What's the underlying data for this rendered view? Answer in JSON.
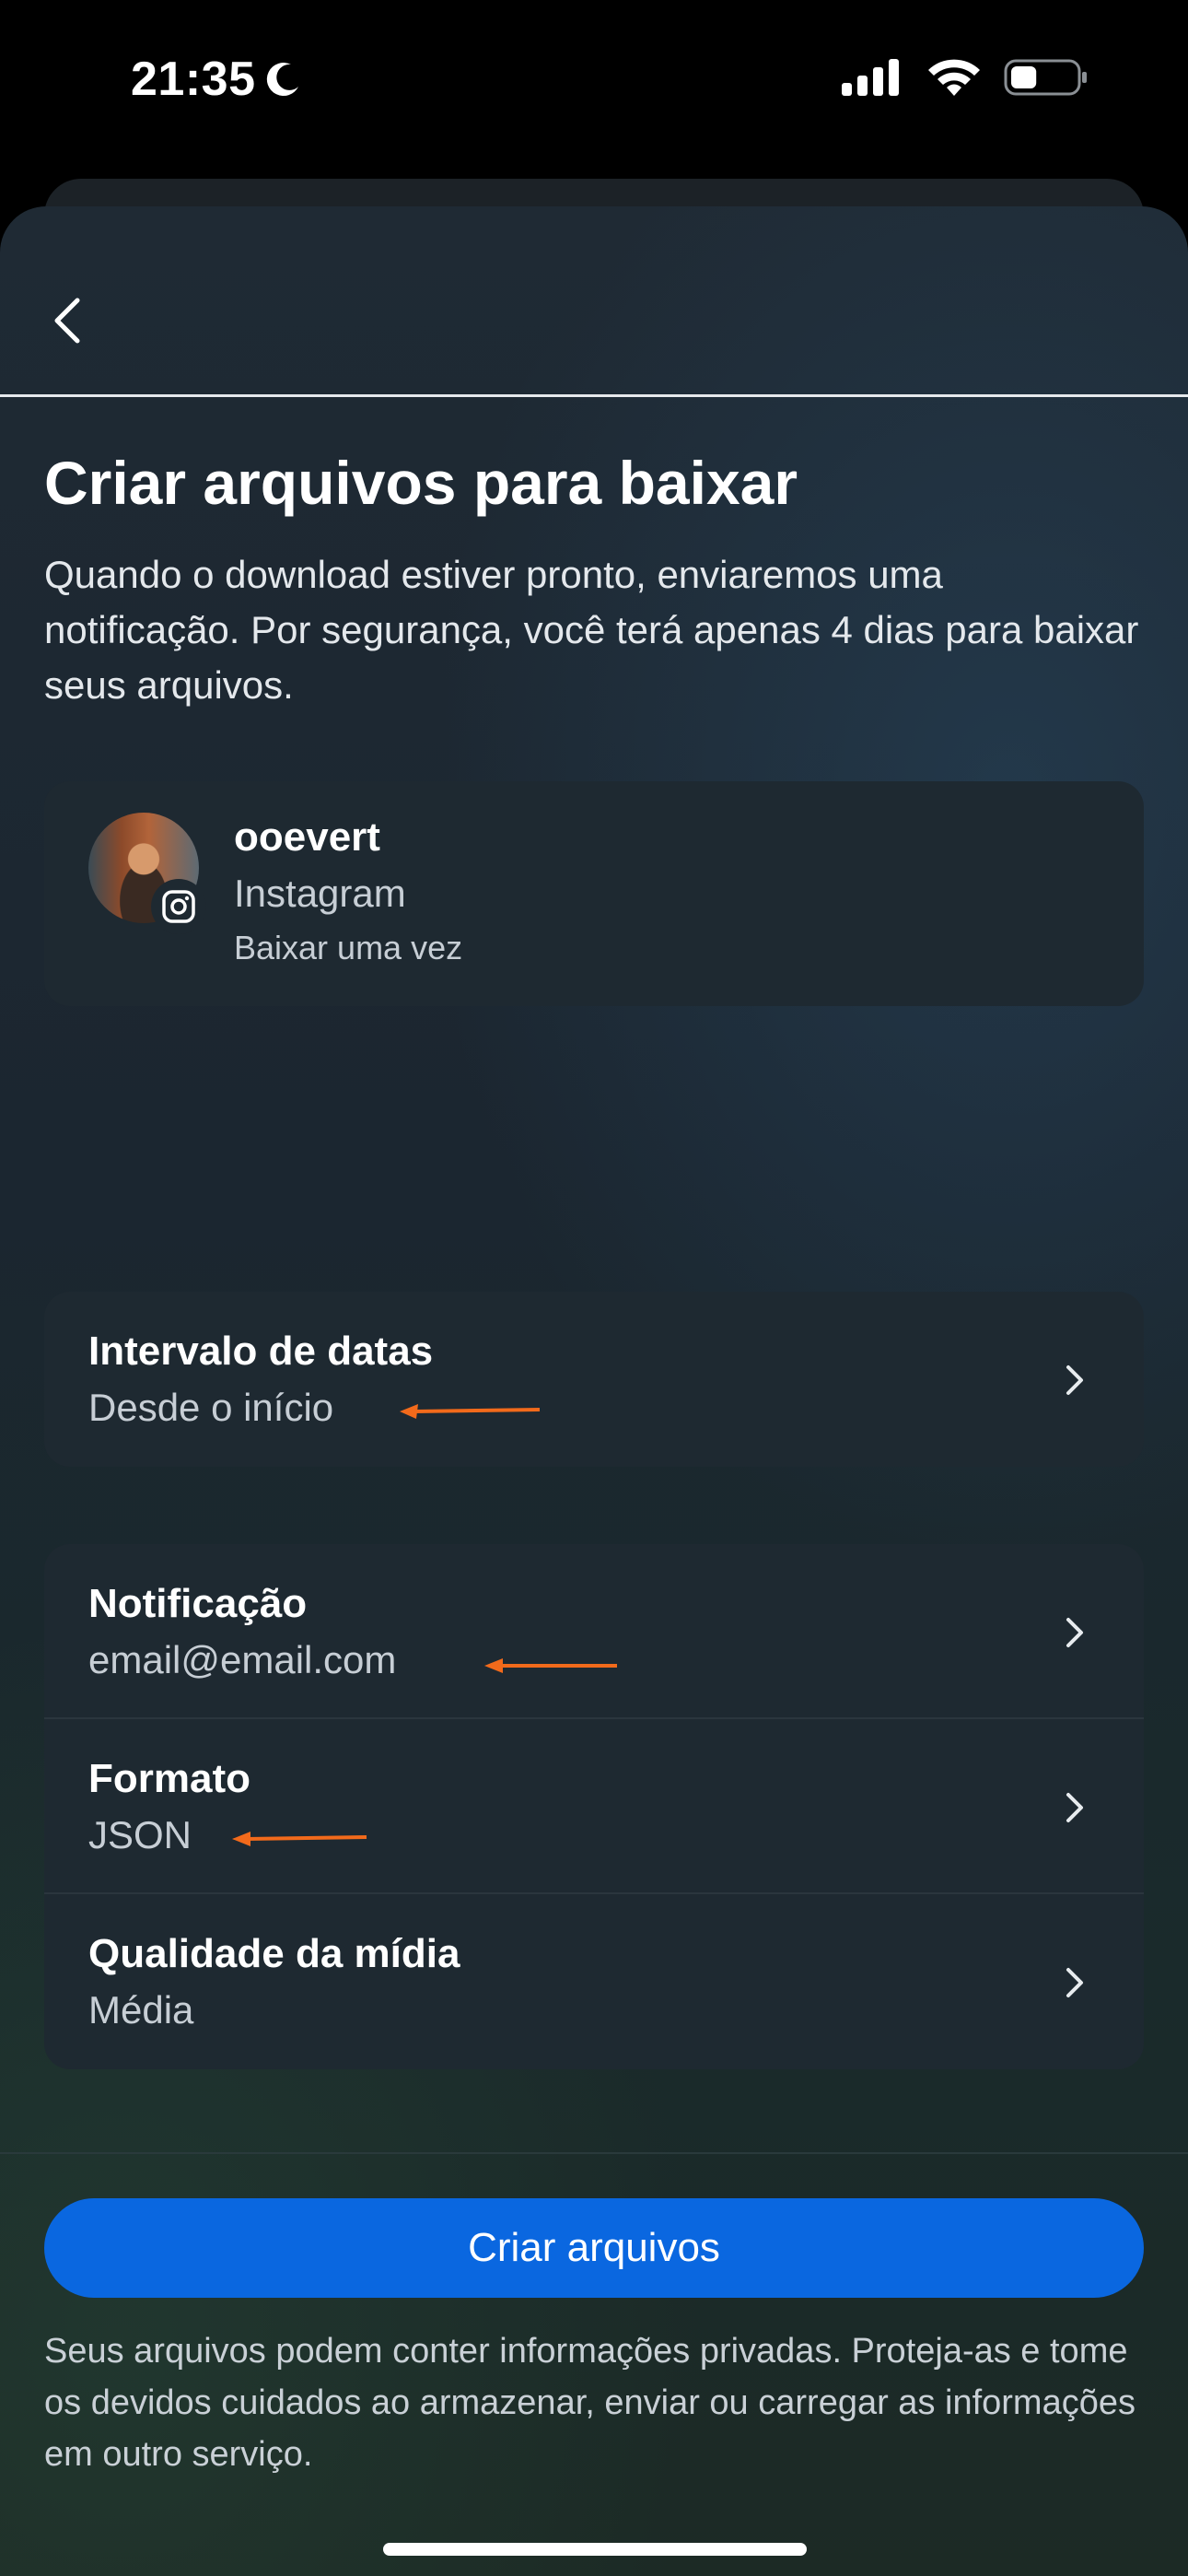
{
  "status_bar": {
    "time": "21:35",
    "moon_icon": "moon-icon",
    "signal_icon": "cellular-signal-icon",
    "wifi_icon": "wifi-icon",
    "battery_icon": "battery-icon",
    "battery_level": 0.4
  },
  "header": {
    "back_icon": "chevron-left-icon",
    "title": "Criar arquivos para baixar",
    "description": "Quando o download estiver pronto, enviaremos uma notificação. Por segurança, você terá apenas 4 dias para baixar seus arquivos."
  },
  "account": {
    "username": "ooevert",
    "platform": "Instagram",
    "mode": "Baixar uma vez",
    "badge_icon": "instagram-icon"
  },
  "date_range": {
    "label": "Intervalo de datas",
    "value": "Desde o início"
  },
  "settings": [
    {
      "label": "Notificação",
      "value": "email@email.com"
    },
    {
      "label": "Formato",
      "value": "JSON"
    },
    {
      "label": "Qualidade da mídia",
      "value": "Média"
    }
  ],
  "annotation_color": "#f26a1b",
  "primary_button": {
    "label": "Criar arquivos",
    "color": "#0a67e0"
  },
  "footer_note": "Seus arquivos podem conter informações privadas. Proteja-as e tome os devidos cuidados ao armazenar, enviar ou carregar as informações em outro serviço."
}
